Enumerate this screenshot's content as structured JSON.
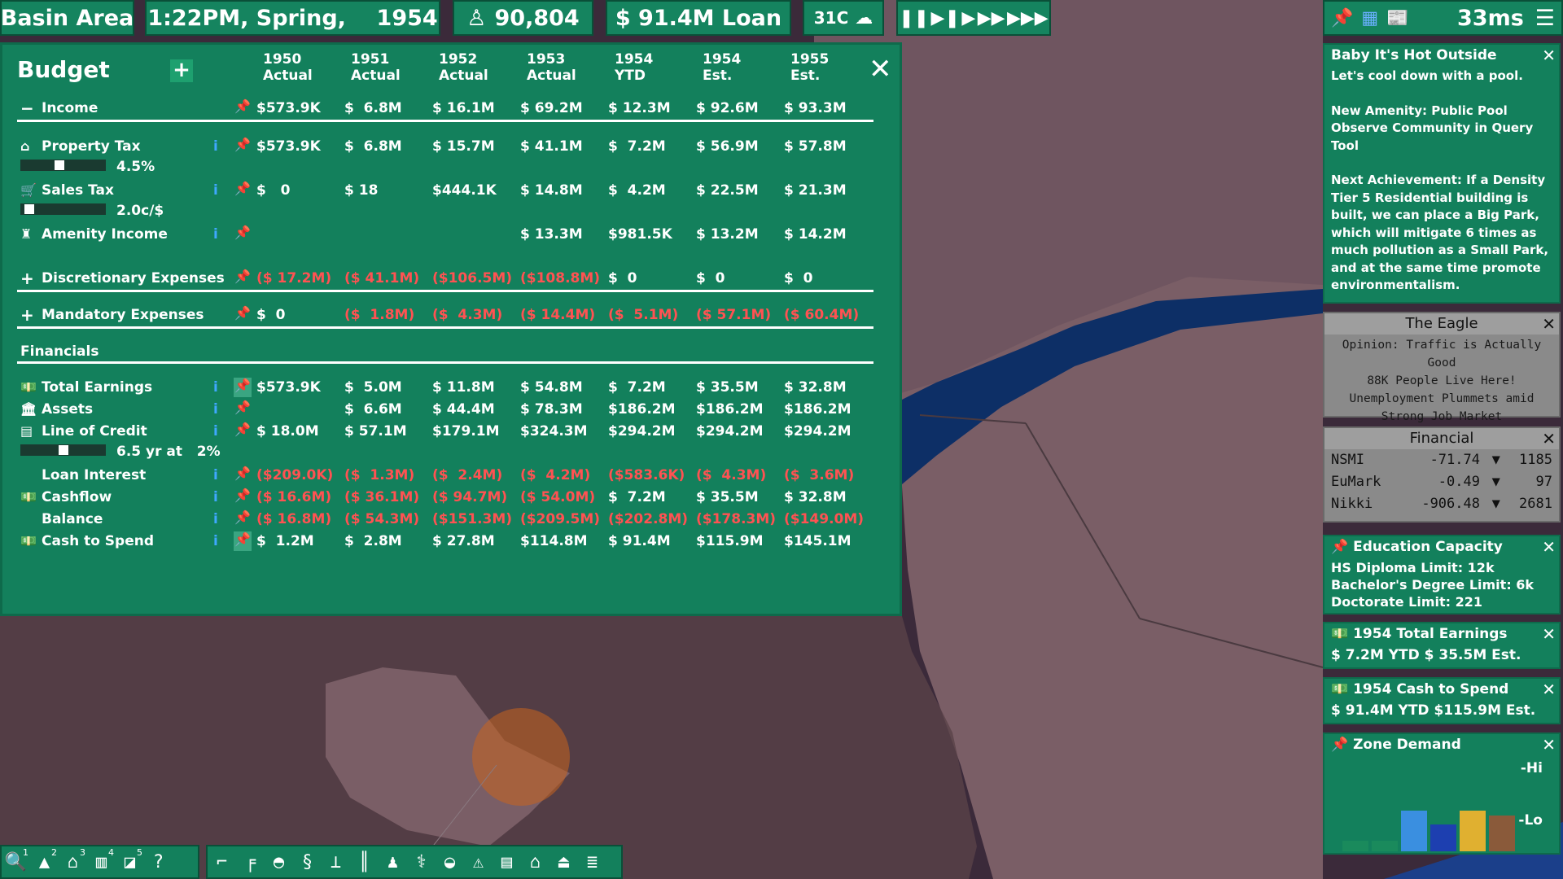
{
  "topbar": {
    "city_name": "Basin Area",
    "datetime": "1:22PM, Spring,    1954",
    "population": "90,804",
    "money": "$ 91.4M Loan",
    "temperature": "31C",
    "frame_time": "33ms"
  },
  "budget": {
    "title": "Budget",
    "years": [
      {
        "year": "1950",
        "kind": "Actual"
      },
      {
        "year": "1951",
        "kind": "Actual"
      },
      {
        "year": "1952",
        "kind": "Actual"
      },
      {
        "year": "1953",
        "kind": "Actual"
      },
      {
        "year": "1954",
        "kind": "YTD"
      },
      {
        "year": "1954",
        "kind": "Est."
      },
      {
        "year": "1955",
        "kind": "Est."
      }
    ],
    "income": {
      "label": "Income",
      "toggle": "−",
      "values": [
        "$573.9K",
        "$  6.8M",
        "$ 16.1M",
        "$ 69.2M",
        "$ 12.3M",
        "$ 92.6M",
        "$ 93.3M"
      ]
    },
    "property_tax": {
      "label": "Property Tax",
      "values": [
        "$573.9K",
        "$  6.8M",
        "$ 15.7M",
        "$ 41.1M",
        "$  7.2M",
        "$ 56.9M",
        "$ 57.8M"
      ],
      "rate_text": "4.5%",
      "rate_value": 0.45
    },
    "sales_tax": {
      "label": "Sales Tax",
      "values": [
        "$   0",
        "$ 18",
        "$444.1K",
        "$ 14.8M",
        "$  4.2M",
        "$ 22.5M",
        "$ 21.3M"
      ],
      "rate_text": "2.0c/$",
      "rate_value": 0.05
    },
    "amenity_income": {
      "label": "Amenity Income",
      "values": [
        "",
        "",
        "",
        "$ 13.3M",
        "$981.5K",
        "$ 13.2M",
        "$ 14.2M"
      ]
    },
    "discretionary": {
      "label": "Discretionary Expenses",
      "toggle": "+",
      "values": [
        "($ 17.2M)",
        "($ 41.1M)",
        "($106.5M)",
        "($108.8M)",
        "$  0",
        "$  0",
        "$  0"
      ]
    },
    "mandatory": {
      "label": "Mandatory Expenses",
      "toggle": "+",
      "values": [
        "$  0",
        "($  1.8M)",
        "($  4.3M)",
        "($ 14.4M)",
        "($  5.1M)",
        "($ 57.1M)",
        "($ 60.4M)"
      ]
    },
    "financials_label": "Financials",
    "total_earnings": {
      "label": "Total Earnings",
      "values": [
        "$573.9K",
        "$  5.0M",
        "$ 11.8M",
        "$ 54.8M",
        "$  7.2M",
        "$ 35.5M",
        "$ 32.8M"
      ]
    },
    "assets": {
      "label": "Assets",
      "values": [
        "",
        "$  6.6M",
        "$ 44.4M",
        "$ 78.3M",
        "$186.2M",
        "$186.2M",
        "$186.2M"
      ]
    },
    "line_of_credit": {
      "label": "Line of Credit",
      "values": [
        "$ 18.0M",
        "$ 57.1M",
        "$179.1M",
        "$324.3M",
        "$294.2M",
        "$294.2M",
        "$294.2M"
      ],
      "term_text": "6.5 yr at   2%",
      "term_value": 0.5
    },
    "loan_interest": {
      "label": "Loan Interest",
      "values": [
        "($209.0K)",
        "($  1.3M)",
        "($  2.4M)",
        "($  4.2M)",
        "($583.6K)",
        "($  4.3M)",
        "($  3.6M)"
      ]
    },
    "cashflow": {
      "label": "Cashflow",
      "values": [
        "($ 16.6M)",
        "($ 36.1M)",
        "($ 94.7M)",
        "($ 54.0M)",
        "$  7.2M",
        "$ 35.5M",
        "$ 32.8M"
      ]
    },
    "balance": {
      "label": "Balance",
      "values": [
        "($ 16.8M)",
        "($ 54.3M)",
        "($151.3M)",
        "($209.5M)",
        "($202.8M)",
        "($178.3M)",
        "($149.0M)"
      ]
    },
    "cash_to_spend": {
      "label": "Cash to Spend",
      "values": [
        "$  1.2M",
        "$  2.8M",
        "$ 27.8M",
        "$114.8M",
        "$ 91.4M",
        "$115.9M",
        "$145.1M"
      ]
    }
  },
  "notif": {
    "title": "Baby It's Hot Outside",
    "p1": "Let's cool down with a pool.",
    "p2": "New Amenity: Public Pool Observe Community in Query Tool",
    "p3": "Next Achievement: If a Density Tier 5 Residential building is built, we can place a Big Park, which will mitigate 6 times as much pollution as a Small Park, and at the same time promote environmentalism."
  },
  "eagle": {
    "title": "The Eagle",
    "headlines": [
      "Opinion: Traffic is Actually Good",
      "88K People Live Here!",
      "Unemployment Plummets amid Strong Job Market"
    ]
  },
  "financial": {
    "title": "Financial",
    "markets": [
      {
        "name": "NSMI",
        "change": "-71.74",
        "value": "1185"
      },
      {
        "name": "EuMark",
        "change": "-0.49",
        "value": "97"
      },
      {
        "name": "Nikki",
        "change": "-906.48",
        "value": "2681"
      }
    ]
  },
  "education": {
    "title": "Education Capacity",
    "lines": [
      "HS Diploma Limit: 12k",
      "Bachelor's Degree Limit: 6k",
      "Doctorate Limit: 221"
    ]
  },
  "earnings_widget": {
    "title": "1954 Total Earnings",
    "text": "$  7.2M YTD  $ 35.5M Est."
  },
  "cash_widget": {
    "title": "1954 Cash to Spend",
    "text": "$ 91.4M YTD  $115.9M Est."
  },
  "zone": {
    "title": "Zone Demand",
    "hi": "-Hi",
    "lo": "-Lo",
    "bars": [
      {
        "name": "residential",
        "level": 0.12,
        "color": "#1a8a5c"
      },
      {
        "name": "residential-tall",
        "level": 0.12,
        "color": "#1a8a5c"
      },
      {
        "name": "retail",
        "level": 0.45,
        "color": "#3a8fe0"
      },
      {
        "name": "office",
        "level": 0.3,
        "color": "#1d3fb0"
      },
      {
        "name": "farm",
        "level": 0.45,
        "color": "#e0b030"
      },
      {
        "name": "industry",
        "level": 0.4,
        "color": "#8a5a3a"
      }
    ]
  },
  "toolbar": {
    "left": [
      {
        "icon": "search-icon",
        "glyph": "🔍",
        "num": "1"
      },
      {
        "icon": "roads-icon",
        "glyph": "▲",
        "num": "2"
      },
      {
        "icon": "residential-icon",
        "glyph": "⌂",
        "num": "3"
      },
      {
        "icon": "factory-icon",
        "glyph": "▥",
        "num": "4"
      },
      {
        "icon": "bulldoze-icon",
        "glyph": "◪",
        "num": "5"
      },
      {
        "icon": "help-icon",
        "glyph": "?",
        "num": ""
      }
    ],
    "right": [
      {
        "icon": "road-tool-icon",
        "glyph": "⌐"
      },
      {
        "icon": "transit-icon",
        "glyph": "╒"
      },
      {
        "icon": "education-icon",
        "glyph": "◓"
      },
      {
        "icon": "finance-icon",
        "glyph": "§"
      },
      {
        "icon": "parks-icon",
        "glyph": "⊥"
      },
      {
        "icon": "monument-icon",
        "glyph": "║"
      },
      {
        "icon": "community-icon",
        "glyph": "♟"
      },
      {
        "icon": "health-icon",
        "glyph": "⚕"
      },
      {
        "icon": "police-icon",
        "glyph": "◒"
      },
      {
        "icon": "warning-icon",
        "glyph": "⚠"
      },
      {
        "icon": "bus-icon",
        "glyph": "▤"
      },
      {
        "icon": "home-icon",
        "glyph": "⌂"
      },
      {
        "icon": "amenity-icon",
        "glyph": "⏏"
      },
      {
        "icon": "news-icon",
        "glyph": "≣"
      }
    ]
  }
}
